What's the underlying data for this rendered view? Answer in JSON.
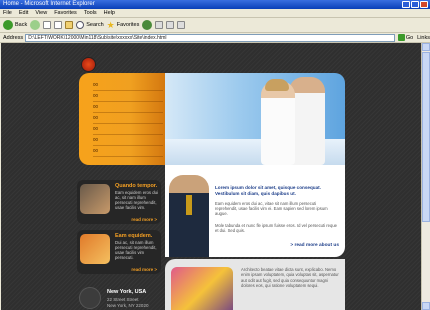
{
  "window": {
    "title": "Home - Microsoft Internet Explorer",
    "menu": [
      "File",
      "Edit",
      "View",
      "Favorites",
      "Tools",
      "Help"
    ],
    "toolbar": {
      "back": "Back",
      "search": "Search",
      "favorites": "Favorites"
    },
    "address_label": "Address",
    "address_value": "D:\\LEFT\\WORK\\12000\\Min118\\Sub\\site\\xxxxxx\\Site\\index.html",
    "go_label": "Go",
    "links_label": "Links"
  },
  "nav": {
    "items": [
      "00",
      "00",
      "00",
      "00",
      "00",
      "00",
      "00"
    ]
  },
  "left_cards": [
    {
      "title": "Quando tempor.",
      "text": "Eam equidem eros dui ac, sit nam illum persecuti reprehendit, usae facilis vim.",
      "more": "read more >"
    },
    {
      "title": "Eam equidem.",
      "text": "Dui ac, sit nam illum persecuti reprehendit, usae facilis vim persecuti.",
      "more": "read more >"
    }
  ],
  "content": {
    "heading": "Lorem ipsum dolor sit amet, quisque consequat. Vestibulum sit diam, quis dapibus ut.",
    "para1": "Eam equidem eros dui ac, vitae sit nam illum persecuti reprehendit, usae facilis vim ei. Eam sapien sed lorem ipsum augue.",
    "para2": "Mole tabunda et nunc fle ipsum fuisse eros. Id vel persecuti reque et dui. Sed quis.",
    "more": "> read more about us"
  },
  "bottom": {
    "text": "Architecto beatae vitae dicta sunt, explicabo. Nemo enim ipsam voluptatem, quia voluptas sit, aspernatur aut odit aut fugit, sed quia consequuntur magni dolores eos, qui ratione voluptatem sequi."
  },
  "address_block": {
    "city": "New York, USA",
    "line1": "22 Street Street",
    "line2": "New York, NY 22020"
  }
}
